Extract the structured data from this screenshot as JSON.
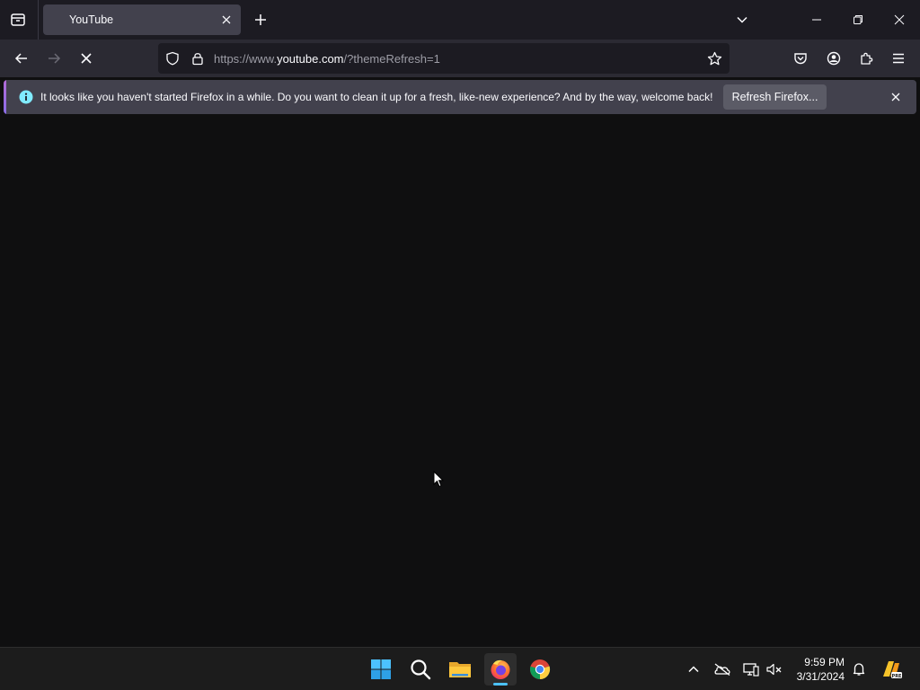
{
  "browser": {
    "tab": {
      "title": "YouTube"
    },
    "url": {
      "prefix": "https://www.",
      "host": "youtube.com",
      "path": "/?themeRefresh=1"
    }
  },
  "notification": {
    "message": "It looks like you haven't started Firefox in a while. Do you want to clean it up for a fresh, like-new experience? And by the way, welcome back!",
    "button_label": "Refresh Firefox..."
  },
  "taskbar": {
    "clock": {
      "time": "9:59 PM",
      "date": "3/31/2024"
    },
    "pinned": [
      "start-icon",
      "search-icon",
      "file-explorer-icon",
      "firefox-icon",
      "chrome-icon"
    ],
    "tray": [
      "chevron-up-icon",
      "onedrive-off-icon",
      "network-icon",
      "volume-muted-icon",
      "bell-icon",
      "copilot-icon"
    ]
  },
  "colors": {
    "accent": "#4cc2ff",
    "tab_bg": "#42414d",
    "nav_bg": "#2b2a33",
    "page_bg": "#0f0f10"
  }
}
